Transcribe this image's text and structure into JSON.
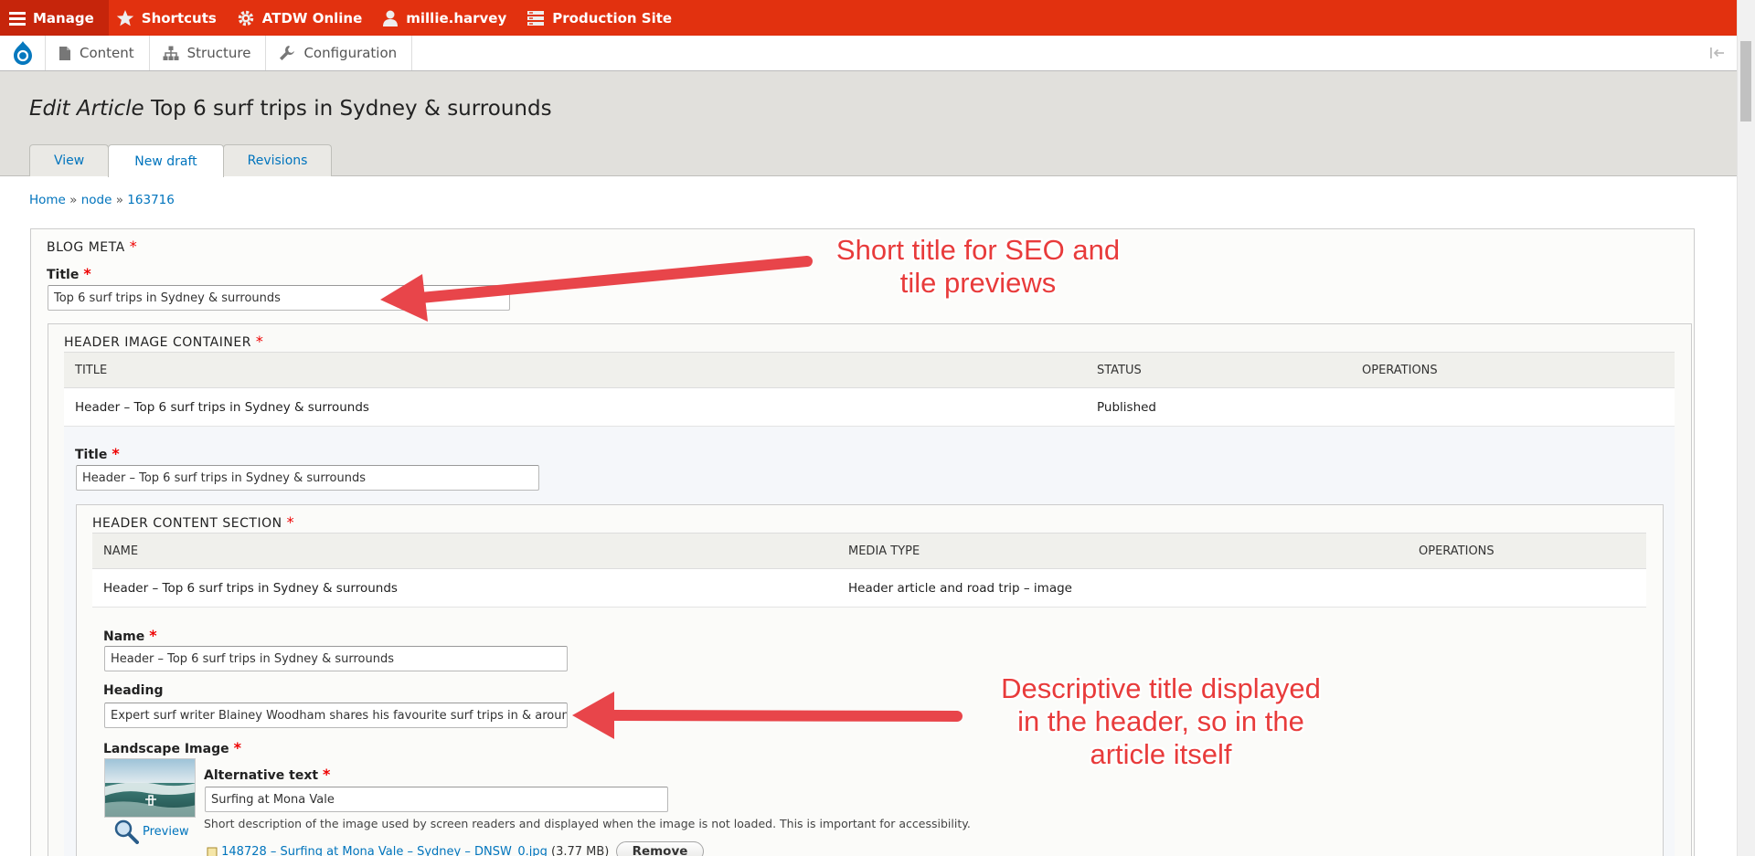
{
  "toolbar": {
    "manage": "Manage",
    "shortcuts": "Shortcuts",
    "site": "ATDW Online",
    "user": "millie.harvey",
    "environment": "Production Site"
  },
  "tray": {
    "content": "Content",
    "structure": "Structure",
    "configuration": "Configuration"
  },
  "header": {
    "title_prefix": "Edit Article",
    "title": "Top 6 surf trips in Sydney & surrounds",
    "tabs": [
      {
        "label": "View"
      },
      {
        "label": "New draft"
      },
      {
        "label": "Revisions"
      }
    ]
  },
  "breadcrumb": {
    "items": [
      "Home",
      "node",
      "163716"
    ],
    "separator": "»"
  },
  "form": {
    "blog_meta": {
      "legend": "BLOG META",
      "title_label": "Title",
      "title_value": "Top 6 surf trips in Sydney & surrounds"
    },
    "header_image_container": {
      "legend": "HEADER IMAGE CONTAINER",
      "columns": [
        "TITLE",
        "STATUS",
        "OPERATIONS"
      ],
      "row": {
        "title": "Header – Top 6 surf trips in Sydney & surrounds",
        "status": "Published"
      },
      "title_label": "Title",
      "title_value": "Header – Top 6 surf trips in Sydney & surrounds"
    },
    "header_content_section": {
      "legend": "HEADER CONTENT SECTION",
      "columns": [
        "NAME",
        "MEDIA TYPE",
        "OPERATIONS"
      ],
      "row": {
        "name": "Header – Top 6 surf trips in Sydney & surrounds",
        "media_type": "Header article and road trip – image"
      },
      "name_label": "Name",
      "name_value": "Header – Top 6 surf trips in Sydney & surrounds",
      "heading_label": "Heading",
      "heading_value": "Expert surf writer Blainey Woodham shares his favourite surf trips in & around",
      "landscape_label": "Landscape Image",
      "alt_label": "Alternative text",
      "alt_value": "Surfing at Mona Vale",
      "alt_description": "Short description of the image used by screen readers and displayed when the image is not loaded. This is important for accessibility.",
      "preview_label": "Preview",
      "file_name": "148728 – Surfing at Mona Vale – Sydney – DNSW_0.jpg",
      "file_size": "(3.77 MB)",
      "remove_label": "Remove"
    }
  },
  "annotations": {
    "seo": [
      "Short title for SEO and",
      "tile previews"
    ],
    "heading": [
      "Descriptive title displayed",
      "in the header, so in the",
      "article itself"
    ]
  },
  "colors": {
    "toolbar": "#e2310f",
    "link": "#0074bd",
    "required": "#e00000",
    "annotation": "#e83b3b"
  }
}
